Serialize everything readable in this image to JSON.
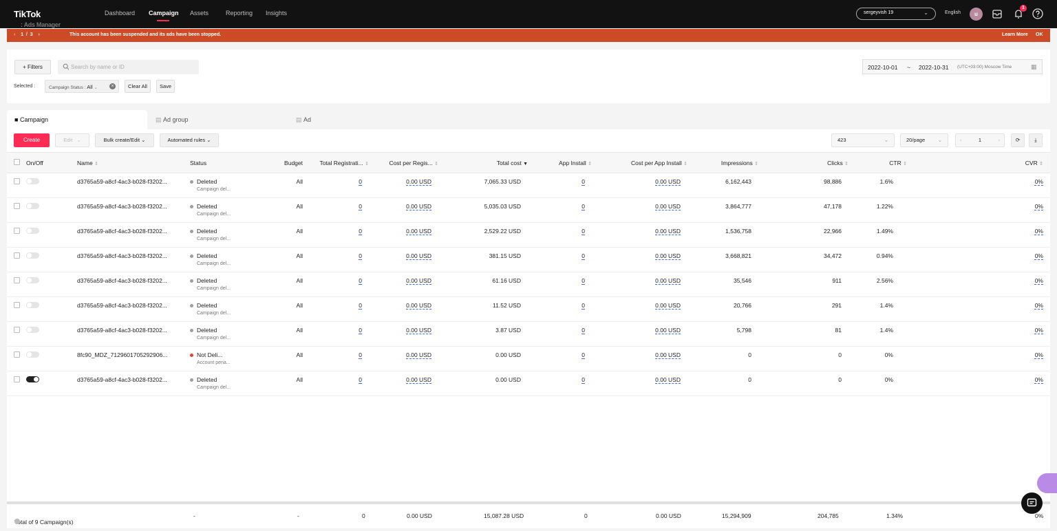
{
  "app": {
    "brand": "TikTok",
    "product": ": Ads Manager"
  },
  "nav": {
    "items": [
      {
        "label": "Dashboard"
      },
      {
        "label": "Campaign"
      },
      {
        "label": "Assets"
      },
      {
        "label": "Reporting"
      },
      {
        "label": "Insights"
      }
    ],
    "active": "Campaign",
    "account": "sergeyvish 19",
    "language": "English",
    "avatar_letter": "u",
    "notification_count": "1"
  },
  "banner": {
    "page_current": "1",
    "page_sep": "/",
    "page_total": "3",
    "message": "This account has been suspended and its ads have been stopped.",
    "learn_more": "Learn More",
    "ok": "OK"
  },
  "filters": {
    "filters_button": "+ Filters",
    "search_placeholder": "Search by name or ID",
    "selected_label": "Selected :",
    "chip_label": "Campaign Status :",
    "chip_value": "All",
    "clear_all": "Clear All",
    "save": "Save",
    "date_start": "2022-10-01",
    "date_sep": "~",
    "date_end": "2022-10-31",
    "timezone": "(UTC+03:00) Moscow Time"
  },
  "tabs": [
    {
      "label": "Campaign"
    },
    {
      "label": "Ad group"
    },
    {
      "label": "Ad"
    }
  ],
  "toolbar": {
    "create": "Create",
    "edit": "Edit",
    "bulk": "Bulk create/Edit",
    "automated": "Automated rules",
    "account_id": "423",
    "page_size": "20/page",
    "page": "1"
  },
  "table": {
    "headers": {
      "onoff": "On/Off",
      "name": "Name",
      "status": "Status",
      "budget": "Budget",
      "total_reg": "Total Registrati...",
      "cost_per_reg": "Cost per Regis...",
      "total_cost": "Total cost",
      "app_install": "App Install",
      "cost_per_install": "Cost per App Install",
      "impressions": "Impressions",
      "clicks": "Clicks",
      "ctr": "CTR",
      "cvr": "CVR"
    },
    "rows": [
      {
        "name": "d3765a59-a8cf-4ac3-b028-f3202...",
        "status": "Deleted",
        "status_sub": "Campaign del...",
        "budget": "All",
        "total_reg": "0",
        "cost_per_reg": "0.00 USD",
        "total_cost": "7,065.33 USD",
        "app_install": "0",
        "cost_per_install": "0.00 USD",
        "impressions": "6,162,443",
        "clicks": "98,886",
        "ctr": "1.6%",
        "cvr": "0%",
        "on": false
      },
      {
        "name": "d3765a59-a8cf-4ac3-b028-f3202...",
        "status": "Deleted",
        "status_sub": "Campaign del...",
        "budget": "All",
        "total_reg": "0",
        "cost_per_reg": "0.00 USD",
        "total_cost": "5,035.03 USD",
        "app_install": "0",
        "cost_per_install": "0.00 USD",
        "impressions": "3,864,777",
        "clicks": "47,178",
        "ctr": "1.22%",
        "cvr": "0%",
        "on": false
      },
      {
        "name": "d3765a59-a8cf-4ac3-b028-f3202...",
        "status": "Deleted",
        "status_sub": "Campaign del...",
        "budget": "All",
        "total_reg": "0",
        "cost_per_reg": "0.00 USD",
        "total_cost": "2,529.22 USD",
        "app_install": "0",
        "cost_per_install": "0.00 USD",
        "impressions": "1,536,758",
        "clicks": "22,966",
        "ctr": "1.49%",
        "cvr": "0%",
        "on": false
      },
      {
        "name": "d3765a59-a8cf-4ac3-b028-f3202...",
        "status": "Deleted",
        "status_sub": "Campaign del...",
        "budget": "All",
        "total_reg": "0",
        "cost_per_reg": "0.00 USD",
        "total_cost": "381.15 USD",
        "app_install": "0",
        "cost_per_install": "0.00 USD",
        "impressions": "3,668,821",
        "clicks": "34,472",
        "ctr": "0.94%",
        "cvr": "0%",
        "on": false
      },
      {
        "name": "d3765a59-a8cf-4ac3-b028-f3202...",
        "status": "Deleted",
        "status_sub": "Campaign del...",
        "budget": "All",
        "total_reg": "0",
        "cost_per_reg": "0.00 USD",
        "total_cost": "61.16 USD",
        "app_install": "0",
        "cost_per_install": "0.00 USD",
        "impressions": "35,546",
        "clicks": "911",
        "ctr": "2.56%",
        "cvr": "0%",
        "on": false
      },
      {
        "name": "d3765a59-a8cf-4ac3-b028-f3202...",
        "status": "Deleted",
        "status_sub": "Campaign del...",
        "budget": "All",
        "total_reg": "0",
        "cost_per_reg": "0.00 USD",
        "total_cost": "11.52 USD",
        "app_install": "0",
        "cost_per_install": "0.00 USD",
        "impressions": "20,766",
        "clicks": "291",
        "ctr": "1.4%",
        "cvr": "0%",
        "on": false
      },
      {
        "name": "d3765a59-a8cf-4ac3-b028-f3202...",
        "status": "Deleted",
        "status_sub": "Campaign del...",
        "budget": "All",
        "total_reg": "0",
        "cost_per_reg": "0.00 USD",
        "total_cost": "3.87 USD",
        "app_install": "0",
        "cost_per_install": "0.00 USD",
        "impressions": "5,798",
        "clicks": "81",
        "ctr": "1.4%",
        "cvr": "0%",
        "on": false
      },
      {
        "name": "8fc90_MDZ_7129601705292906...",
        "status": "Not Deli...",
        "status_sub": "Account pena...",
        "budget": "All",
        "total_reg": "0",
        "cost_per_reg": "0.00 USD",
        "total_cost": "0.00 USD",
        "app_install": "0",
        "cost_per_install": "0.00 USD",
        "impressions": "0",
        "clicks": "0",
        "ctr": "0%",
        "cvr": "0%",
        "on": false
      },
      {
        "name": "d3765a59-a8cf-4ac3-b028-f3202...",
        "status": "Deleted",
        "status_sub": "Campaign del...",
        "budget": "All",
        "total_reg": "0",
        "cost_per_reg": "0.00 USD",
        "total_cost": "0.00 USD",
        "app_install": "0",
        "cost_per_install": "0.00 USD",
        "impressions": "0",
        "clicks": "0",
        "ctr": "0%",
        "cvr": "0%",
        "on": true
      }
    ],
    "totals": {
      "label": "Total of 9 Campaign(s)",
      "status": "-",
      "budget": "-",
      "total_reg": "0",
      "cost_per_reg": "0.00 USD",
      "total_cost": "15,087.28 USD",
      "app_install": "0",
      "cost_per_install": "0.00 USD",
      "impressions": "15,294,909",
      "clicks": "204,785",
      "ctr": "1.34%",
      "cvr": "0%"
    }
  },
  "colors": {
    "accent": "#fe2c55",
    "banner": "#cc4a26",
    "deleted_dot": "#9e9e9e",
    "not_delivering_dot": "#e0452b",
    "topbar": "#121212"
  }
}
